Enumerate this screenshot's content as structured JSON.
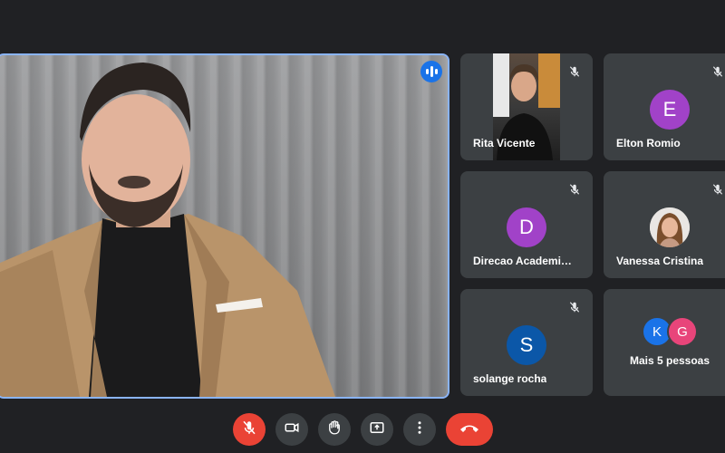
{
  "main_speaker": {
    "speaking_indicator": "audio-wave-icon"
  },
  "participants": [
    {
      "name": "Rita Vicente",
      "type": "video",
      "muted": true
    },
    {
      "name": "Elton Romio",
      "type": "avatar",
      "initial": "E",
      "avatar_color": "#a142c8",
      "muted": true
    },
    {
      "name": "Direcao Academi…",
      "type": "avatar",
      "initial": "D",
      "avatar_color": "#a142c8",
      "muted": true
    },
    {
      "name": "Vanessa Cristina",
      "type": "photo",
      "muted": true
    },
    {
      "name": "solange rocha",
      "type": "avatar",
      "initial": "S",
      "avatar_color": "#0b57a8",
      "muted": true
    }
  ],
  "more": {
    "label": "Mais 5 pessoas",
    "initials": [
      "K",
      "G"
    ],
    "colors": [
      "#1a73e8",
      "#e8457a"
    ]
  },
  "controls": [
    {
      "name": "microphone-off",
      "icon": "mic-off-icon"
    },
    {
      "name": "camera",
      "icon": "camera-icon"
    },
    {
      "name": "raise-hand",
      "icon": "hand-icon"
    },
    {
      "name": "present-screen",
      "icon": "present-icon"
    },
    {
      "name": "more-options",
      "icon": "more-vert-icon"
    },
    {
      "name": "leave-call",
      "icon": "phone-hangup-icon"
    }
  ],
  "colors": {
    "background": "#202124",
    "tile": "#3c4043",
    "active_border": "#8ab4f8",
    "danger": "#ea4335"
  }
}
